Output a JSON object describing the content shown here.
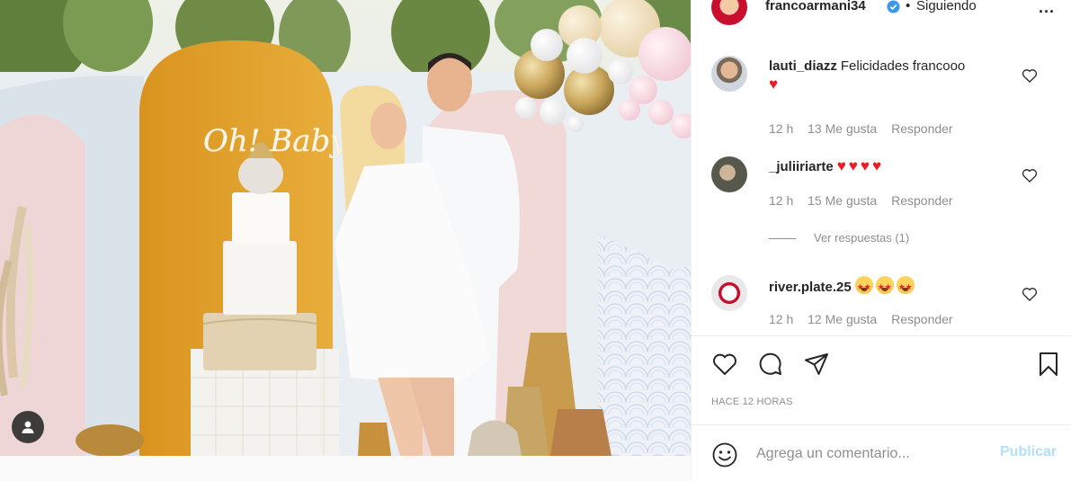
{
  "post": {
    "username": "francoarmani34",
    "verified": true,
    "separator": "•",
    "follow_status": "Siguiendo",
    "more": "..."
  },
  "photo": {
    "cake_topper_text": "Oh! Baby",
    "tag_icon": "user-tag-icon"
  },
  "comments": [
    {
      "username": "lauti_diazz",
      "text": "Felicidades francooo",
      "emoji": [
        "red-heart"
      ],
      "time": "12 h",
      "likes": "13 Me gusta",
      "reply": "Responder"
    },
    {
      "username": "_juliiriarte",
      "text": "",
      "emoji": [
        "red-heart",
        "red-heart",
        "red-heart",
        "red-heart"
      ],
      "time": "12 h",
      "likes": "15 Me gusta",
      "reply": "Responder",
      "view_replies": "Ver respuestas (1)"
    },
    {
      "username": "river.plate.25",
      "text": "",
      "emoji": [
        "star-struck",
        "star-struck",
        "star-struck"
      ],
      "time": "12 h",
      "likes": "12 Me gusta",
      "reply": "Responder"
    }
  ],
  "actions": {
    "icons": [
      "heart-icon",
      "comment-icon",
      "share-icon",
      "bookmark-icon"
    ],
    "time_ago": "HACE 12 HORAS"
  },
  "add_comment": {
    "placeholder": "Agrega un comentario...",
    "publish_label": "Publicar",
    "emoji_icon": "smiley-icon"
  },
  "colors": {
    "link": "#b2dffc",
    "secondary_text": "#8e8e8e",
    "verified": "#3897f0",
    "heart": "#ed1c24"
  }
}
